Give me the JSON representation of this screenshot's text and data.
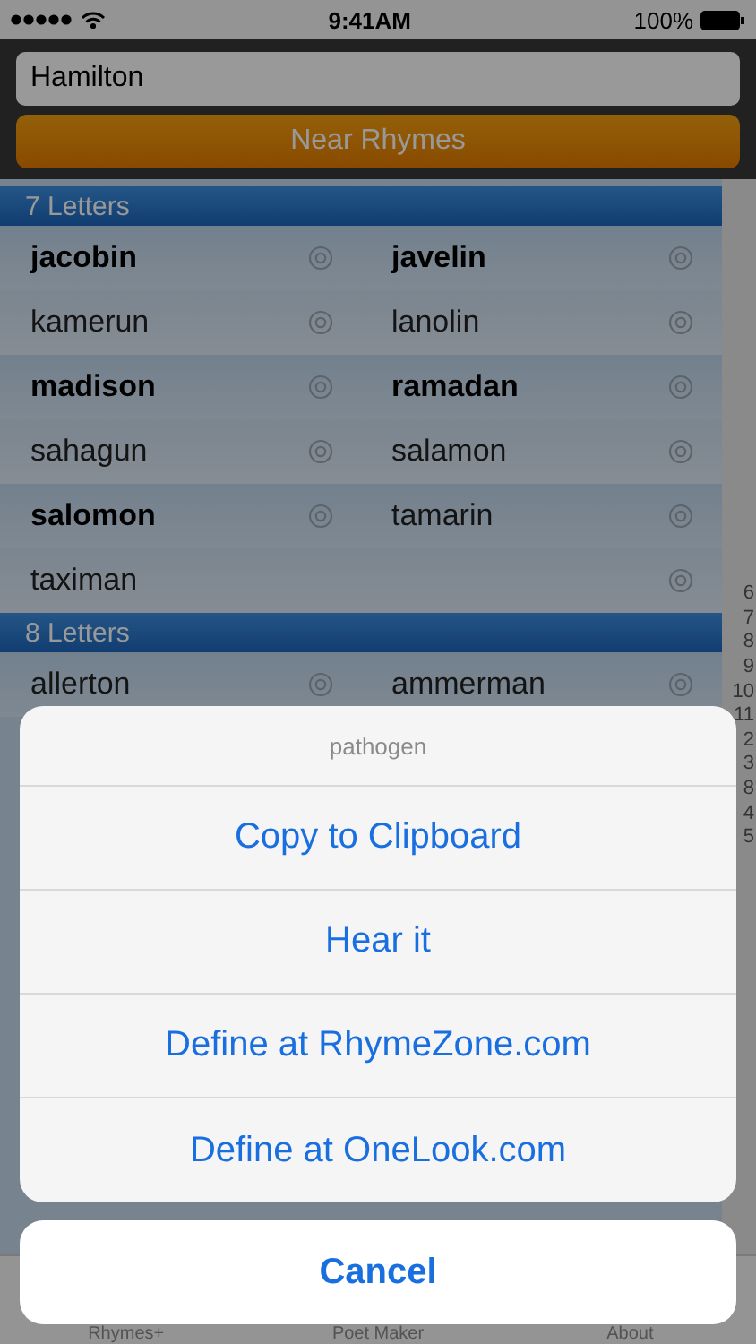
{
  "status_bar": {
    "time": "9:41AM",
    "battery": "100%"
  },
  "search": {
    "value": "Hamilton"
  },
  "mode_button": {
    "label": "Near Rhymes"
  },
  "sections": [
    {
      "title": "7 Letters",
      "rows": [
        [
          {
            "word": "jacobin",
            "bold": true
          },
          {
            "word": "javelin",
            "bold": true
          }
        ],
        [
          {
            "word": "kamerun",
            "bold": false
          },
          {
            "word": "lanolin",
            "bold": false
          }
        ],
        [
          {
            "word": "madison",
            "bold": true
          },
          {
            "word": "ramadan",
            "bold": true
          }
        ],
        [
          {
            "word": "sahagun",
            "bold": false
          },
          {
            "word": "salamon",
            "bold": false
          }
        ],
        [
          {
            "word": "salomon",
            "bold": true
          },
          {
            "word": "tamarin",
            "bold": false
          }
        ],
        [
          {
            "word": "taximan",
            "bold": false
          }
        ]
      ]
    },
    {
      "title": "8 Letters",
      "rows": [
        [
          {
            "word": "allerton",
            "bold": false
          },
          {
            "word": "ammerman",
            "bold": false
          }
        ]
      ]
    }
  ],
  "index": [
    "6",
    "7",
    "8",
    "9",
    "10",
    "11",
    "2",
    "3",
    "8",
    "4",
    "5"
  ],
  "tab_bar": {
    "items": [
      {
        "label": "Rhymes+"
      },
      {
        "label": "Poet Maker"
      },
      {
        "label": "About"
      }
    ]
  },
  "action_sheet": {
    "title": "pathogen",
    "actions": [
      "Copy to Clipboard",
      "Hear it",
      "Define at RhymeZone.com",
      "Define at OneLook.com"
    ],
    "cancel": "Cancel"
  }
}
